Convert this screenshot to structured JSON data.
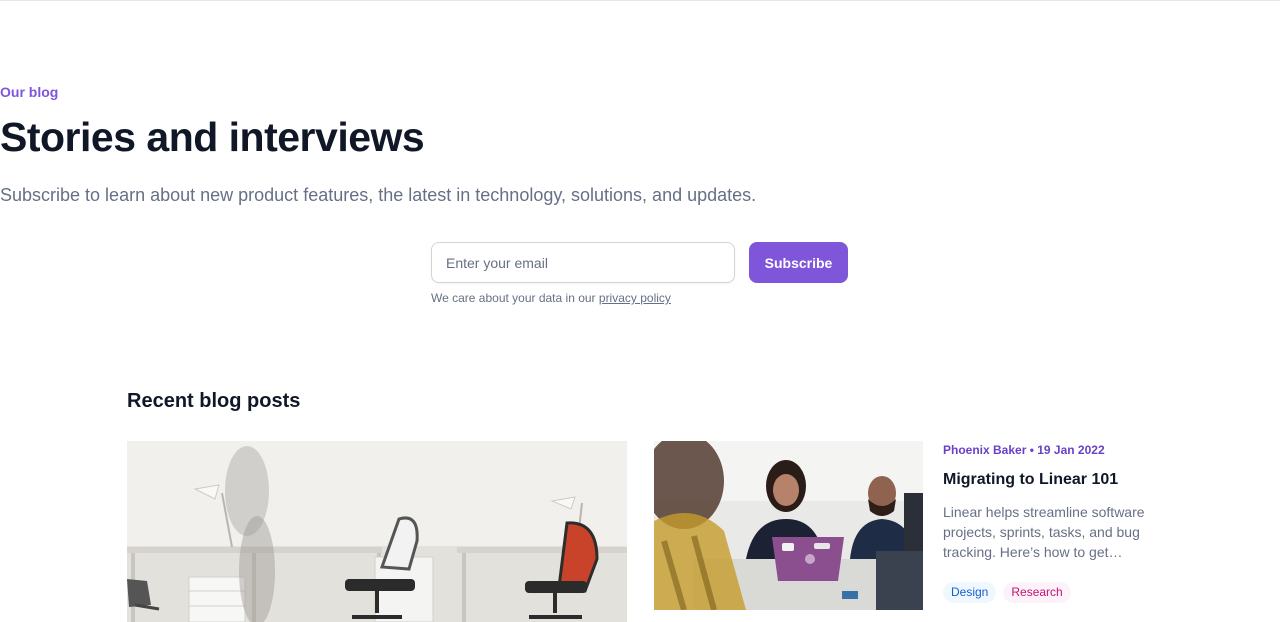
{
  "hero": {
    "eyebrow": "Our blog",
    "title": "Stories and interviews",
    "subtitle": "Subscribe to learn about new product features, the latest in technology, solutions, and updates."
  },
  "subscribe": {
    "placeholder": "Enter your email",
    "button_label": "Subscribe",
    "privacy_prefix": "We care about your data in our",
    "privacy_link": "privacy policy"
  },
  "recent": {
    "section_title": "Recent blog posts",
    "featured_post": {
      "meta": "Phoenix Baker • 19 Jan 2022",
      "title": "Migrating to Linear 101",
      "excerpt": "Linear helps streamline software projects, sprints, tasks, and bug tracking. Here’s how to get…",
      "tags": [
        {
          "label": "Design"
        },
        {
          "label": "Research"
        }
      ]
    }
  },
  "colors": {
    "accent": "#7f56d9",
    "heading": "#101828",
    "body": "#667085"
  }
}
